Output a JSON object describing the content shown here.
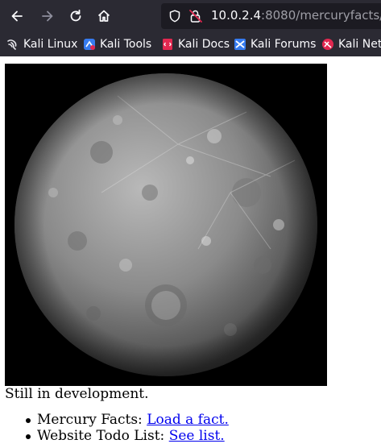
{
  "browser": {
    "url_host": "10.0.2.4",
    "url_rest": ":8080/mercuryfacts/",
    "bookmarks": [
      {
        "label": "Kali Linux",
        "icon": "kali-dragon-icon"
      },
      {
        "label": "Kali Tools",
        "icon": "kali-tools-icon"
      },
      {
        "label": "Kali Docs",
        "icon": "kali-docs-icon"
      },
      {
        "label": "Kali Forums",
        "icon": "kali-forums-icon"
      },
      {
        "label": "Kali Net",
        "icon": "kali-nethunter-icon"
      }
    ]
  },
  "page": {
    "image_alt": "",
    "caption": "Still in development.",
    "items": [
      {
        "prefix": "Mercury Facts: ",
        "link": "Load a fact."
      },
      {
        "prefix": "Website Todo List: ",
        "link": "See list."
      }
    ]
  },
  "colors": {
    "chrome": "#2b2a33",
    "urlbar": "#1c1b22",
    "link": "#0000ee"
  }
}
